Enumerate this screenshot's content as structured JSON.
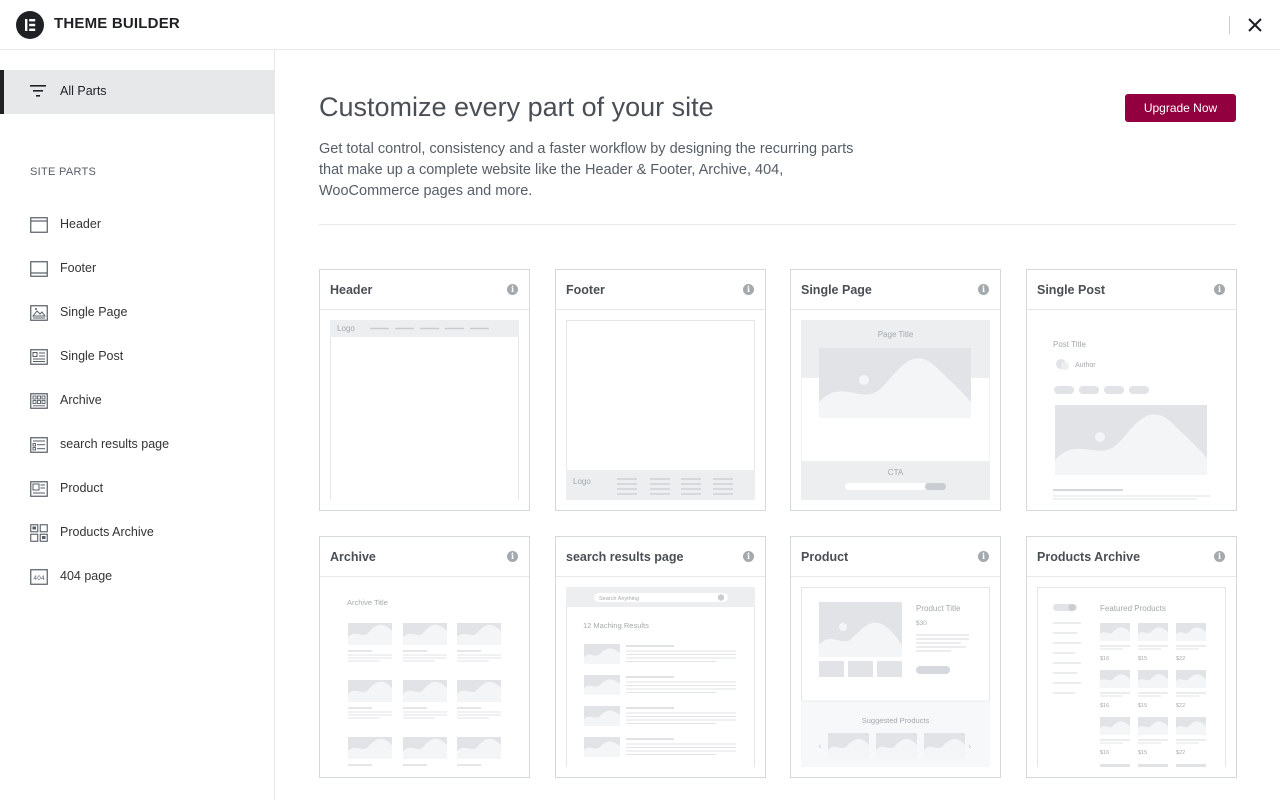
{
  "app": {
    "title": "THEME BUILDER",
    "close_label": "Close"
  },
  "colors": {
    "accent": "#93003f",
    "dark": "#1f2124",
    "sidebar_active_bg": "#e6e8ea"
  },
  "sidebar": {
    "all_parts_label": "All Parts",
    "section_label": "SITE PARTS",
    "items": [
      {
        "label": "Header",
        "icon": "header-icon"
      },
      {
        "label": "Footer",
        "icon": "footer-icon"
      },
      {
        "label": "Single Page",
        "icon": "single-page-icon"
      },
      {
        "label": "Single Post",
        "icon": "single-post-icon"
      },
      {
        "label": "Archive",
        "icon": "archive-icon"
      },
      {
        "label": "search results page",
        "icon": "search-results-icon"
      },
      {
        "label": "Product",
        "icon": "product-icon"
      },
      {
        "label": "Products Archive",
        "icon": "products-archive-icon"
      },
      {
        "label": "404 page",
        "icon": "404-page-icon"
      }
    ]
  },
  "main": {
    "title": "Customize every part of your site",
    "description": "Get total control, consistency and a faster workflow by designing the recurring parts that make up a complete website like the Header & Footer, Archive, 404, WooCommerce pages and more.",
    "upgrade_label": "Upgrade Now",
    "cards": [
      {
        "title": "Header"
      },
      {
        "title": "Footer"
      },
      {
        "title": "Single Page"
      },
      {
        "title": "Single Post"
      },
      {
        "title": "Archive"
      },
      {
        "title": "search results page"
      },
      {
        "title": "Product"
      },
      {
        "title": "Products Archive"
      }
    ],
    "thumb_text": {
      "header_logo": "Logo",
      "footer_logo": "Logo",
      "page_title": "Page Title",
      "cta": "CTA",
      "post_title": "Post Title",
      "author": "Author",
      "archive_title": "Archive Title",
      "search_placeholder": "Search Anything",
      "results_count": "12 Maching Results",
      "product_title": "Product Title",
      "product_price": "$30",
      "suggested_products": "Suggested Products",
      "featured_products": "Featured Products",
      "prices": [
        "$16",
        "$15",
        "$22"
      ]
    }
  }
}
